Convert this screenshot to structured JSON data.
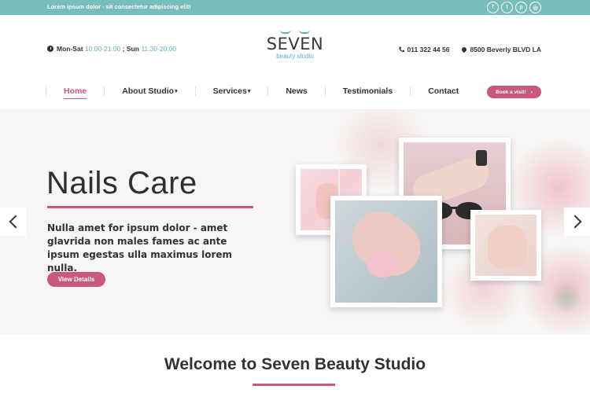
{
  "topbar": {
    "text": "Lorem ipsum dolor - sit consectetur adipiscing elit!",
    "socials": [
      {
        "icon": "facebook-icon",
        "glyph": "f"
      },
      {
        "icon": "twitter-icon",
        "glyph": "t"
      },
      {
        "icon": "pinterest-icon",
        "glyph": "p"
      },
      {
        "icon": "instagram-icon",
        "glyph": "◎"
      }
    ]
  },
  "header": {
    "hours_label_1": "Mon-Sat",
    "hours_value_1": "10:00-21:00",
    "hours_sep": ";",
    "hours_label_2": "Sun",
    "hours_value_2": "11:30-20:00",
    "phone": "011 322 44 56",
    "address": "8500 Beverly BLVD LA"
  },
  "logo": {
    "title": "SEVEN",
    "subtitle": "beauty studio"
  },
  "nav": {
    "items": [
      "Home",
      "About Studio",
      "Services",
      "News",
      "Testimonials",
      "Contact"
    ],
    "book_label": "Book a visit!",
    "book_arrow": "›"
  },
  "hero": {
    "title": "Nails Care",
    "text": "Nulla amet for ipsum dolor - amet glavrida non males fames ac ante ipsum egestas ulla maximus lorem nulla.",
    "button": "View Details"
  },
  "welcome": {
    "title": "Welcome to Seven Beauty Studio"
  },
  "colors": {
    "accent": "#c8587e",
    "teal": "#78bcbc"
  }
}
